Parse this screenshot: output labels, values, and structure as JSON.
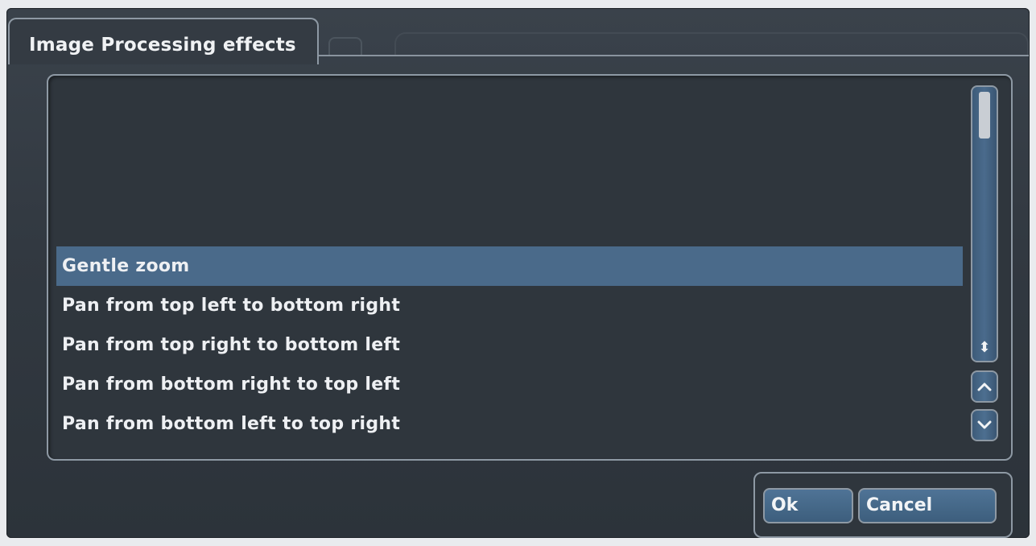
{
  "dialog": {
    "title": "Image Processing effects"
  },
  "list": {
    "items": [
      {
        "label": "Gentle zoom",
        "selected": true
      },
      {
        "label": "Pan from top left to bottom right",
        "selected": false
      },
      {
        "label": "Pan from top right to bottom left",
        "selected": false
      },
      {
        "label": "Pan from bottom right to top left",
        "selected": false
      },
      {
        "label": "Pan from bottom left to top right",
        "selected": false
      }
    ]
  },
  "scrollbar": {
    "updown_icon": "⬍",
    "up_icon": "chevron-up-icon",
    "down_icon": "chevron-down-icon"
  },
  "buttons": {
    "ok_label": "Ok",
    "cancel_label": "Cancel"
  },
  "colors": {
    "background": "#323941",
    "accent": "#4a6a8a",
    "border": "#8e99a4",
    "text": "#eef0f3"
  }
}
